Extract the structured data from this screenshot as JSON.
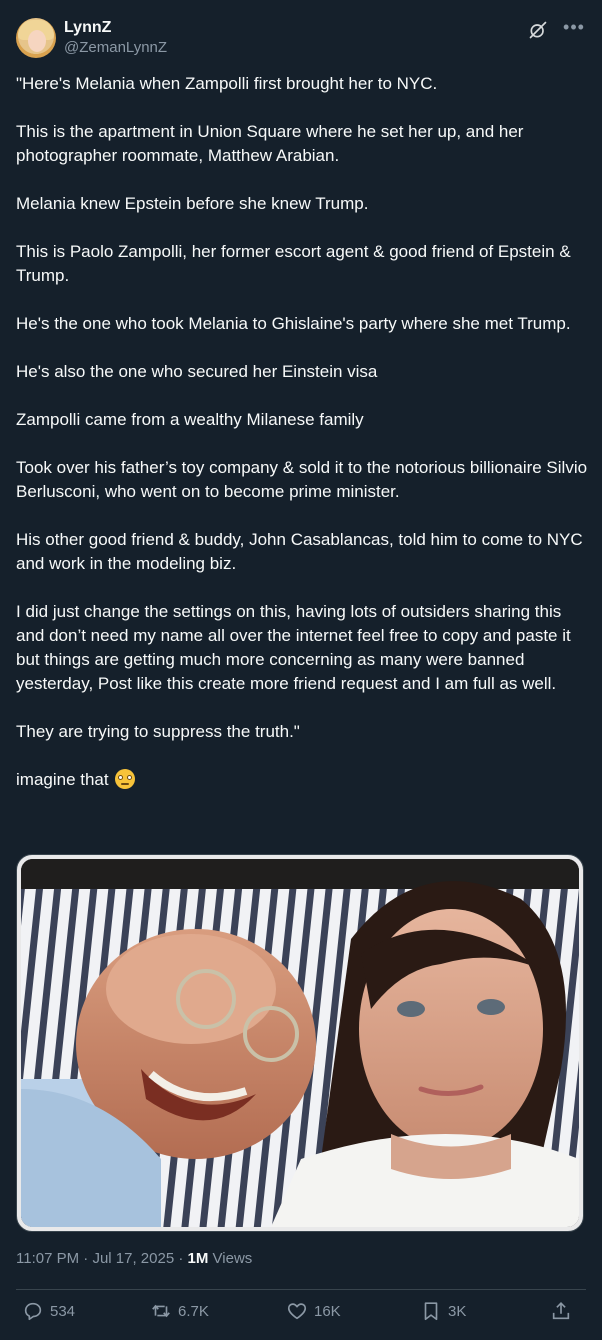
{
  "author": {
    "display_name": "LynnZ",
    "handle": "@ZemanLynnZ"
  },
  "tweet": {
    "paragraphs": [
      "\"Here's Melania when Zampolli first brought her to NYC.",
      "This is the apartment in Union Square where he set her up, and her photographer roommate, Matthew Arabian.",
      "Melania knew Epstein before she knew Trump.",
      "This is Paolo Zampolli, her former escort agent & good friend of Epstein & Trump.",
      "He's the one who took Melania to Ghislaine's party where she met Trump.",
      "He's also the one who secured her Einstein visa",
      "Zampolli came from a wealthy Milanese family",
      "Took over his father’s toy company & sold it to the notorious billionaire Silvio Berlusconi, who went on to become prime minister.",
      "His other good friend & buddy, John Casablancas, told him to come to NYC and work in the modeling biz.",
      "I did just change the settings on this, having lots of outsiders sharing this and don’t need my name all over the internet  feel free to copy and paste it but things are getting much more concerning as many were banned yesterday, Post like this create more friend request and I am full as well.",
      "They are trying to suppress the truth.\"",
      "imagine that"
    ],
    "emoji": "face-with-rolling-eyes-icon",
    "time": "11:07 PM",
    "date": "Jul 17, 2025",
    "views_count": "1M",
    "views_label": "Views"
  },
  "actions": {
    "replies": "534",
    "reposts": "6.7K",
    "likes": "16K",
    "bookmarks": "3K"
  },
  "colors": {
    "background": "#15202b",
    "text": "#f7f9f9",
    "secondary": "#8b98a5",
    "border": "#38444d"
  }
}
